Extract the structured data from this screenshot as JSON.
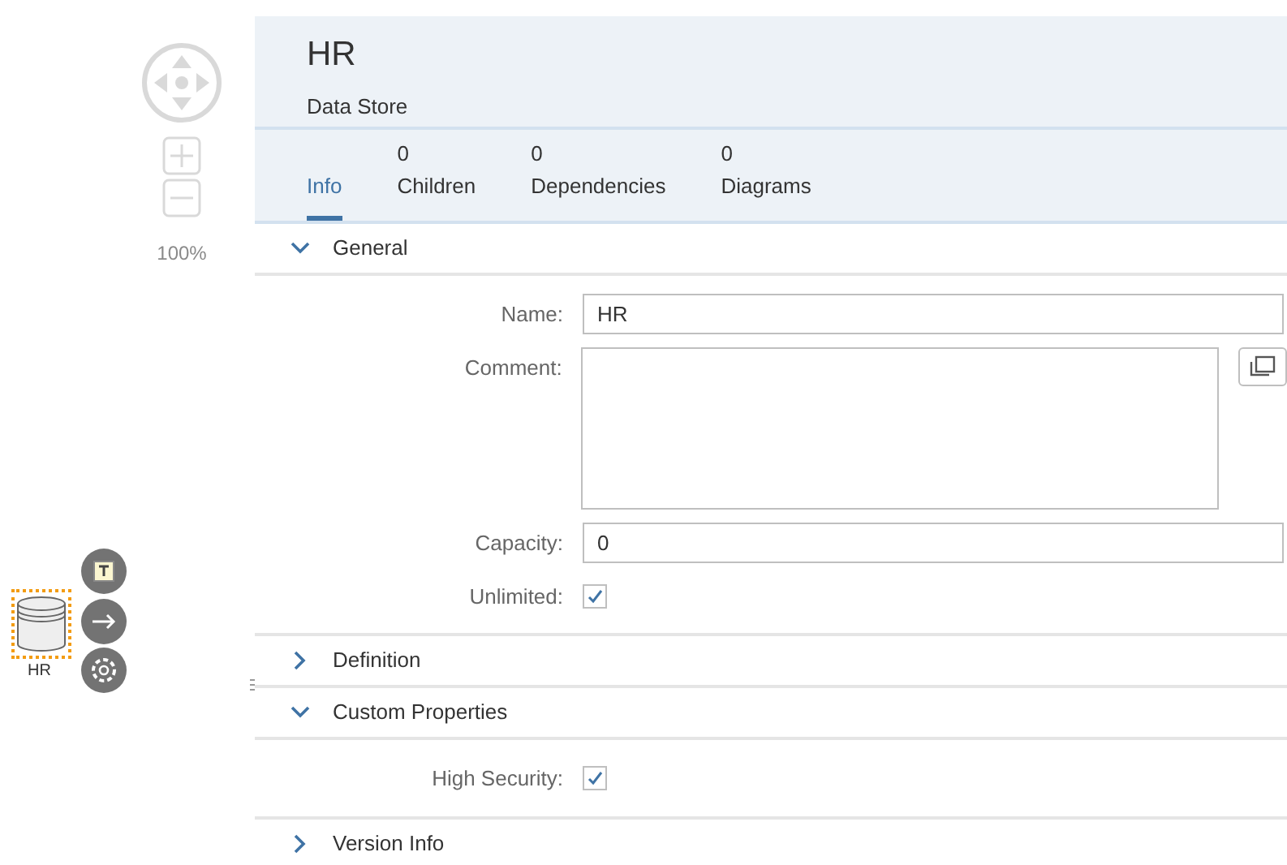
{
  "canvas": {
    "zoom": "100%",
    "node": {
      "label": "HR",
      "selected": true
    }
  },
  "header": {
    "title": "HR",
    "subtitle": "Data Store"
  },
  "tabs": [
    {
      "label": "Info",
      "selected": true
    },
    {
      "count": "0",
      "label": "Children",
      "selected": false
    },
    {
      "count": "0",
      "label": "Dependencies",
      "selected": false
    },
    {
      "count": "0",
      "label": "Diagrams",
      "selected": false
    }
  ],
  "sections": [
    {
      "title": "General",
      "expanded": true,
      "fields": [
        {
          "kind": "text",
          "label": "Name:",
          "value": "HR"
        },
        {
          "kind": "textarea",
          "label": "Comment:"
        },
        {
          "kind": "text",
          "label": "Capacity:",
          "value": "0"
        },
        {
          "kind": "checkbox",
          "label": "Unlimited:",
          "checked": true
        }
      ]
    },
    {
      "title": "Definition",
      "expanded": false
    },
    {
      "title": "Custom Properties",
      "expanded": true,
      "fields": [
        {
          "kind": "checkbox",
          "label": "High Security:",
          "checked": true
        }
      ]
    },
    {
      "title": "Version Info",
      "expanded": false
    }
  ]
}
